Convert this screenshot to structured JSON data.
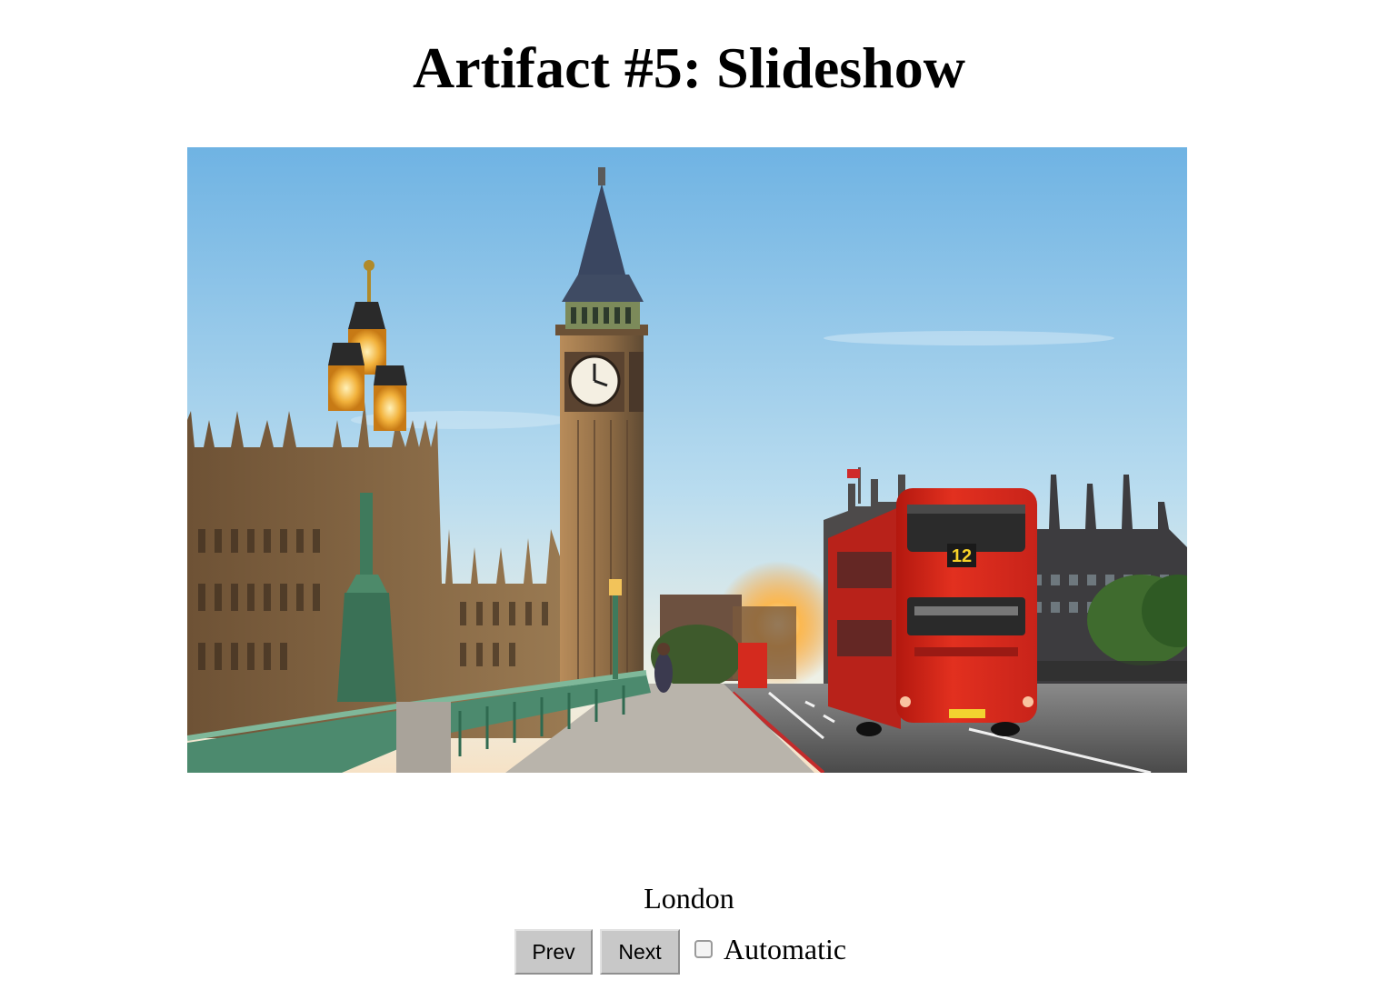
{
  "page": {
    "title": "Artifact #5: Slideshow"
  },
  "slide": {
    "image_alt": "Big Ben and a red double-decker bus on Westminster Bridge",
    "caption": "London",
    "bus_route": "12"
  },
  "controls": {
    "prev_label": "Prev",
    "next_label": "Next",
    "automatic_label": "Automatic",
    "automatic_checked": false
  },
  "colors": {
    "sky_top": "#7fbde6",
    "sky_bottom": "#eef3ee",
    "stone": "#8a6a45",
    "bus_red": "#e12d1f",
    "lamp_green": "#3f7a5c"
  }
}
